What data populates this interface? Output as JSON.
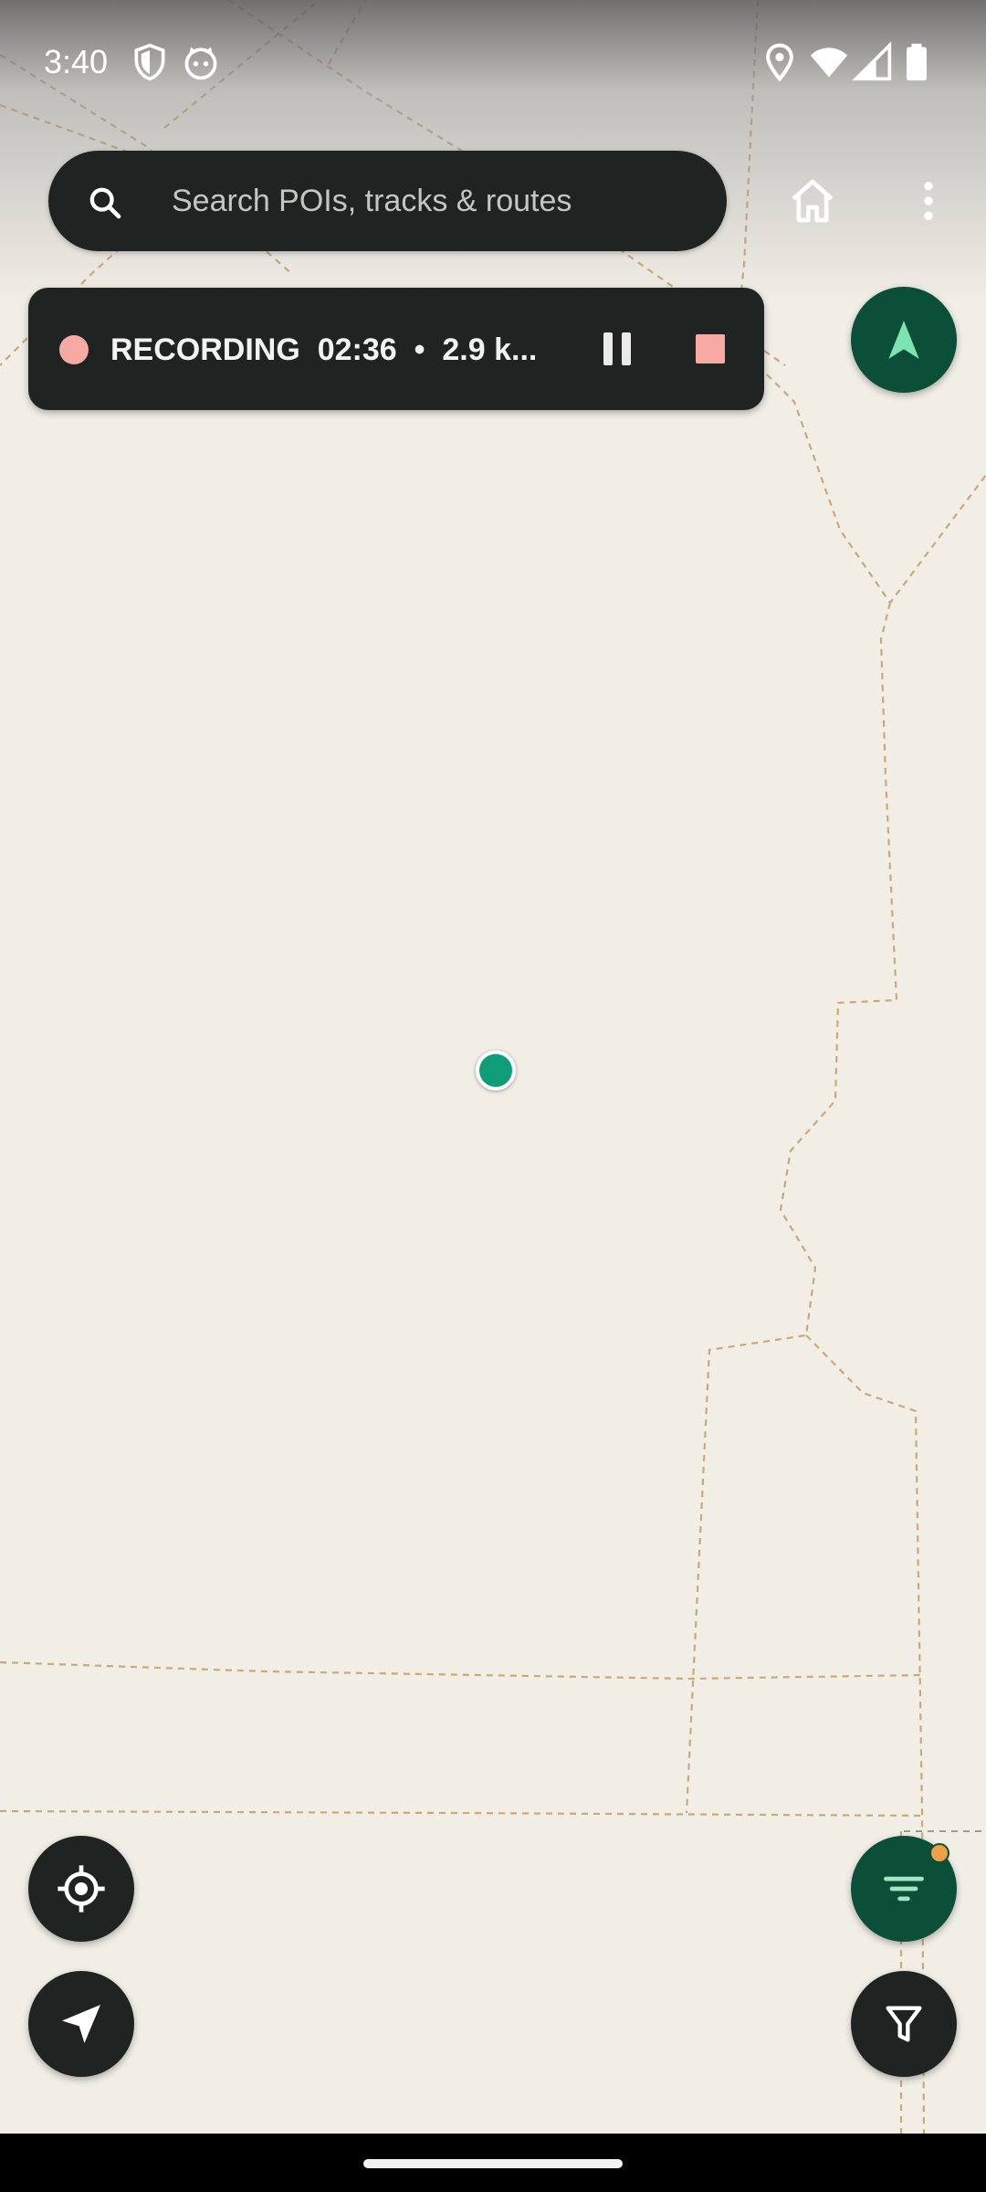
{
  "status_bar": {
    "time": "3:40",
    "left_icons": [
      "shield-icon",
      "cat-face-icon"
    ],
    "right_icons": [
      "location-pin-icon",
      "wifi-icon",
      "cell-signal-icon",
      "battery-icon"
    ]
  },
  "search": {
    "placeholder": "Search POIs, tracks & routes",
    "value": ""
  },
  "top_actions": {
    "home_icon": "home-icon",
    "more_icon": "more-vert-icon"
  },
  "recording": {
    "status": "RECORDING",
    "elapsed": "02:36",
    "separator": "•",
    "distance": "2.9 k...",
    "pause_icon": "pause-icon",
    "stop_icon": "stop-icon"
  },
  "fabs": {
    "compass_icon": "navigation-arrow-icon",
    "locate_icon": "my-location-icon",
    "navigate_icon": "send-arrow-icon",
    "filter_list_icon": "filter-list-icon",
    "filter_icon": "filter-funnel-icon"
  },
  "colors": {
    "map_background": "#f1eee6",
    "map_trail": "#c9a97a",
    "card_dark": "#1f2322",
    "accent_green": "#0b4f38",
    "recording_red": "#f7aaa3",
    "location_dot": "#0f9d78",
    "badge_orange": "#f0a044"
  }
}
